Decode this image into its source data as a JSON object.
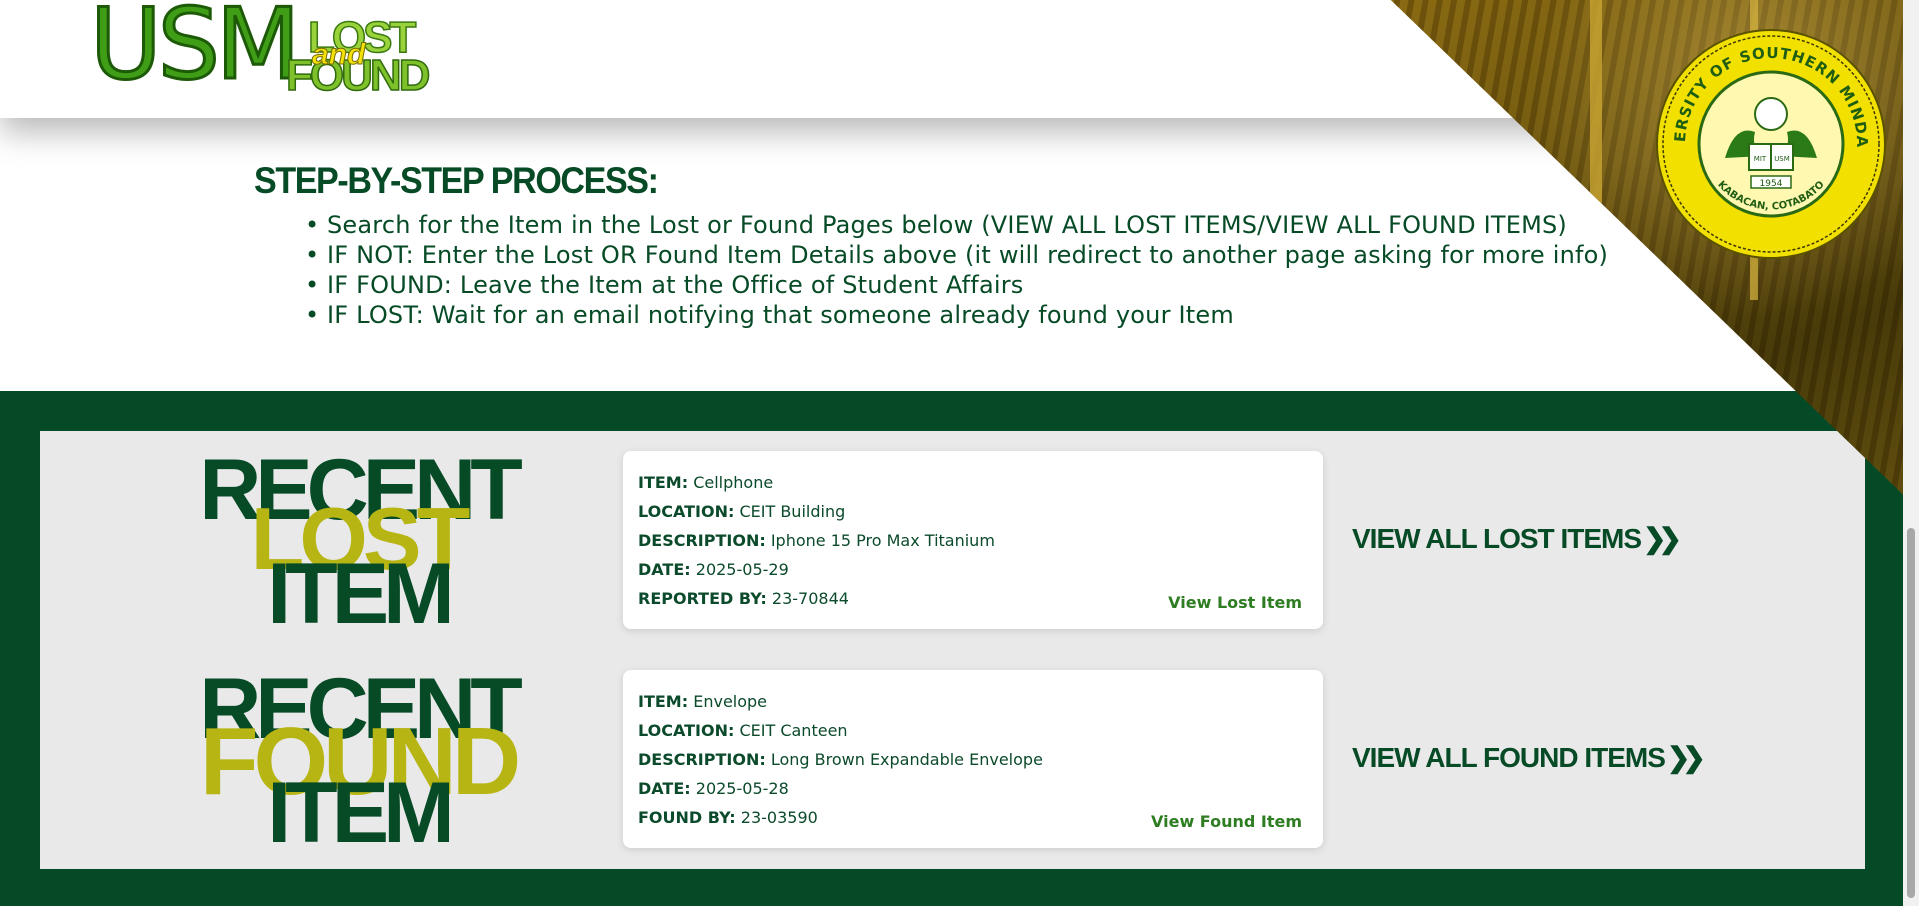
{
  "logo": {
    "usm": "USM",
    "lost": "LOST",
    "and": "and",
    "found": "FOUND"
  },
  "seal": {
    "top_text": "UNIVERSITY OF SOUTHERN MINDANAO",
    "bottom_text": "KABACAN, COTABATO",
    "year": "1954",
    "book_left": "MIT",
    "book_right": "USM"
  },
  "steps": {
    "title": "STEP-BY-STEP PROCESS:",
    "items": [
      "Search for the Item in the Lost or Found Pages below (VIEW ALL LOST ITEMS/VIEW ALL FOUND ITEMS)",
      "IF NOT: Enter the Lost OR Found Item Details above (it will redirect to another page asking for more info)",
      "IF FOUND: Leave the Item at the Office of Student Affairs",
      "IF LOST: Wait for an email notifying that someone already found your Item"
    ]
  },
  "recent_lost": {
    "title_top": "RECENT",
    "title_mid": "LOST",
    "title_bottom": "ITEM",
    "item_label": "ITEM:",
    "item": "Cellphone",
    "location_label": "LOCATION:",
    "location": "CEIT Building",
    "description_label": "DESCRIPTION:",
    "description": "Iphone 15 Pro Max Titanium",
    "date_label": "DATE:",
    "date": "2025-05-29",
    "by_label": "REPORTED BY:",
    "by": "23-70844",
    "view_link": "View Lost Item",
    "view_all": "VIEW ALL LOST ITEMS"
  },
  "recent_found": {
    "title_top": "RECENT",
    "title_mid": "FOUND",
    "title_bottom": "ITEM",
    "item_label": "ITEM:",
    "item": "Envelope",
    "location_label": "LOCATION:",
    "location": "CEIT Canteen",
    "description_label": "DESCRIPTION:",
    "description": "Long Brown Expandable Envelope",
    "date_label": "DATE:",
    "date": "2025-05-28",
    "by_label": "FOUND BY:",
    "by": "23-03590",
    "view_link": "View Found Item",
    "view_all": "VIEW ALL FOUND ITEMS"
  },
  "icons": {
    "chevron": "double-chevron-right-icon"
  },
  "colors": {
    "dark_green": "#054a27",
    "olive": "#b7b514",
    "link_green": "#2e7d22",
    "panel_gray": "#e9e9e9",
    "seal_yellow": "#f2e000"
  }
}
